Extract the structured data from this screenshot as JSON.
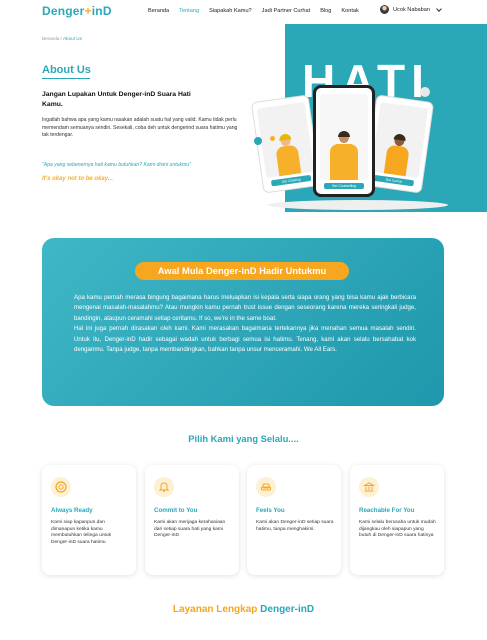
{
  "nav": {
    "logo_prefix": "Denger",
    "logo_mark": "+",
    "logo_suffix": "inD",
    "links": [
      "Beranda",
      "Tentang",
      "Siapakah Kamu?",
      "Jadi Partner Curhat",
      "Blog",
      "Kontak"
    ],
    "active_link": "Tentang",
    "user_name": "Ucok Nababan"
  },
  "breadcrumb": {
    "home": "Beranda",
    "separator": "/",
    "current": "About Us"
  },
  "hero": {
    "title": "About Us",
    "heading": "Jangan Lupakan Untuk Denger-inD Suara Hati Kamu.",
    "description": "Ingatlah bahwa apa yang kamu rasakan adalah suatu hal yang valid. Kamu tidak perlu memendam semuanya sendiri. Sesekali, coba deh untuk dengerind suara hatimu yang tak terdengar.",
    "quote": "\"Apa yang sebenernya hati kamu butuhkan? Kami disini untukmu\"",
    "tagline": "It's okay not to be okay...",
    "big_word": "HATI",
    "phones": {
      "left_button": "Get Chatting",
      "center_button": "Get Counselling",
      "right_button": "Get Curhat"
    }
  },
  "story": {
    "title": "Awal Mula Denger-inD Hadir Untukmu",
    "paragraph1": "Apa kamu pernah merasa bingung bagaimana harus meluapkan isi kepala serta siapa orang yang bisa kamu ajak berbicara mengenai masalah-masalahmu? Atau mungkin kamu pernah trust issue dengan seseorang karena mereka seringkali judge, bandingin, ataupun ceramahi setiap ceritamu. If so, we're in the same boat.",
    "paragraph2": "Hal ini juga pernah dirasakan oleh kami. Kami merasakan bagaimana tertekannya jika menahan semua masalah sendiri. Untuk itu, Denger-inD hadir sebagai wadah untuk berbagi semua isi hatimu. Tenang, kami akan selalu bersahabat kok denganmu. Tanpa judge, tanpa membandingkan, bahkan tanpa unsur menceramahi. We All Ears."
  },
  "choose": {
    "title": "Pilih Kami yang Selalu....",
    "cards": [
      {
        "icon": "lifebuoy-icon",
        "title": "Always Ready",
        "desc": "Kami siap kapanpun dan dimanapun ketika kamu membutuhkan telinga untuk Denger-inD suara hatimu"
      },
      {
        "icon": "bell-icon",
        "title": "Commit to You",
        "desc": "Kami akan menjaga kerahasiaan dari setiap suara hati yang kami Denger-inD"
      },
      {
        "icon": "sofa-icon",
        "title": "Feels You",
        "desc": "Kami akan Denger-inD setiap suara hatimu, tanpa menghakimi."
      },
      {
        "icon": "bank-icon",
        "title": "Reachable For You",
        "desc": "Kami selalu berusaha untuk mudah dijangkau oleh siapapun yang butuh di Denger-inD suara hatinya"
      }
    ]
  },
  "services": {
    "part1": "Layanan Lengkap",
    "part2": "Denger-inD"
  },
  "colors": {
    "primary": "#2aa8b8",
    "accent": "#f6a71f"
  }
}
